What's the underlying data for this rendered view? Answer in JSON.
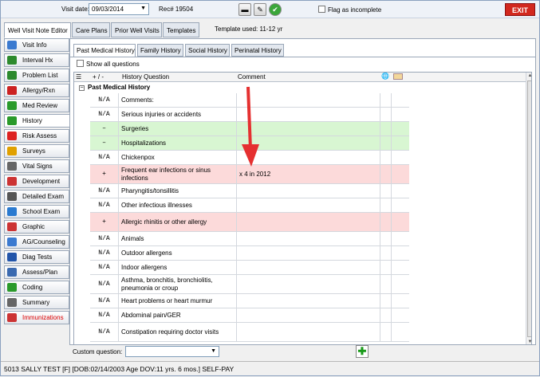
{
  "topbar": {
    "visit_label": "Visit date:",
    "visit_date": "09/03/2014",
    "rec": "Rec# 19504",
    "flag_label": "Flag as incomplete",
    "exit_label": "EXIT"
  },
  "main_tabs": [
    "Well Visit Note Editor",
    "Care Plans",
    "Prior Well Visits",
    "Templates"
  ],
  "template_used": "Template used:  11-12 yr",
  "sidebar": [
    {
      "label": "Visit Info",
      "icon": "visit-icon",
      "color": "#3b7ad0"
    },
    {
      "label": "Interval Hx",
      "icon": "calendar-icon",
      "color": "#2d8a2d"
    },
    {
      "label": "Problem List",
      "icon": "list-icon",
      "color": "#2d8a2d"
    },
    {
      "label": "Allergy/Rxn",
      "icon": "allergy-icon",
      "color": "#c22"
    },
    {
      "label": "Med Review",
      "icon": "med-icon",
      "color": "#2a9a2a"
    },
    {
      "label": "History",
      "icon": "history-icon",
      "color": "#2a9a2a"
    },
    {
      "label": "Risk Assess",
      "icon": "risk-icon",
      "color": "#d22"
    },
    {
      "label": "Surveys",
      "icon": "survey-icon",
      "color": "#e0a000"
    },
    {
      "label": "Vital Signs",
      "icon": "vitals-icon",
      "color": "#666"
    },
    {
      "label": "Development",
      "icon": "development-icon",
      "color": "#c33"
    },
    {
      "label": "Detailed Exam",
      "icon": "exam-icon",
      "color": "#555"
    },
    {
      "label": "School Exam",
      "icon": "school-icon",
      "color": "#2a7ad0"
    },
    {
      "label": "Graphic",
      "icon": "graphic-icon",
      "color": "#c33"
    },
    {
      "label": "AG/Counseling",
      "icon": "counseling-icon",
      "color": "#3b7ad0"
    },
    {
      "label": "Diag Tests",
      "icon": "tests-icon",
      "color": "#2255aa"
    },
    {
      "label": "Assess/Plan",
      "icon": "assess-icon",
      "color": "#3b6ab0"
    },
    {
      "label": "Coding",
      "icon": "coding-icon",
      "color": "#2a9a2a"
    },
    {
      "label": "Summary",
      "icon": "summary-icon",
      "color": "#666"
    },
    {
      "label": "Immunizations",
      "icon": "immunization-icon",
      "color": "#c33"
    }
  ],
  "sub_tabs": [
    "Past Medical History",
    "Family History",
    "Social History",
    "Perinatal History"
  ],
  "show_all_label": "Show all questions",
  "grid": {
    "header_pm": "+ / -",
    "header_question": "History Question",
    "header_comment": "Comment",
    "section_title": "Past Medical History",
    "rows": [
      {
        "pm": "N/A",
        "question": "Comments:",
        "comment": "",
        "status": "none"
      },
      {
        "pm": "N/A",
        "question": "Serious injuries or accidents",
        "comment": "",
        "status": "none"
      },
      {
        "pm": "–",
        "question": "Surgeries",
        "comment": "",
        "status": "neg"
      },
      {
        "pm": "–",
        "question": "Hospitalizations",
        "comment": "",
        "status": "neg"
      },
      {
        "pm": "N/A",
        "question": "Chickenpox",
        "comment": "",
        "status": "none"
      },
      {
        "pm": "+",
        "question": "Frequent ear infections or sinus infections",
        "comment": "x 4 in 2012",
        "status": "pos"
      },
      {
        "pm": "N/A",
        "question": "Pharyngitis/tonsillitis",
        "comment": "",
        "status": "none"
      },
      {
        "pm": "N/A",
        "question": "Other infectious illnesses",
        "comment": "",
        "status": "none"
      },
      {
        "pm": "+",
        "question": "Allergic rhinitis or other allergy",
        "comment": "",
        "status": "pos"
      },
      {
        "pm": "N/A",
        "question": "Animals",
        "comment": "",
        "status": "none"
      },
      {
        "pm": "N/A",
        "question": "Outdoor allergens",
        "comment": "",
        "status": "none"
      },
      {
        "pm": "N/A",
        "question": "Indoor allergens",
        "comment": "",
        "status": "none"
      },
      {
        "pm": "N/A",
        "question": "Asthma, bronchitis, bronchiolitis, pneumonia or croup",
        "comment": "",
        "status": "none"
      },
      {
        "pm": "N/A",
        "question": "Heart problems or heart murmur",
        "comment": "",
        "status": "none"
      },
      {
        "pm": "N/A",
        "question": "Abdominal pain/GER",
        "comment": "",
        "status": "none"
      },
      {
        "pm": "N/A",
        "question": "Constipation requiring doctor visits",
        "comment": "",
        "status": "none"
      }
    ]
  },
  "custom_question_label": "Custom question:",
  "status_bar": "5013 SALLY TEST [F] [DOB:02/14/2003  Age DOV:11 yrs. 6 mos.] SELF-PAY"
}
